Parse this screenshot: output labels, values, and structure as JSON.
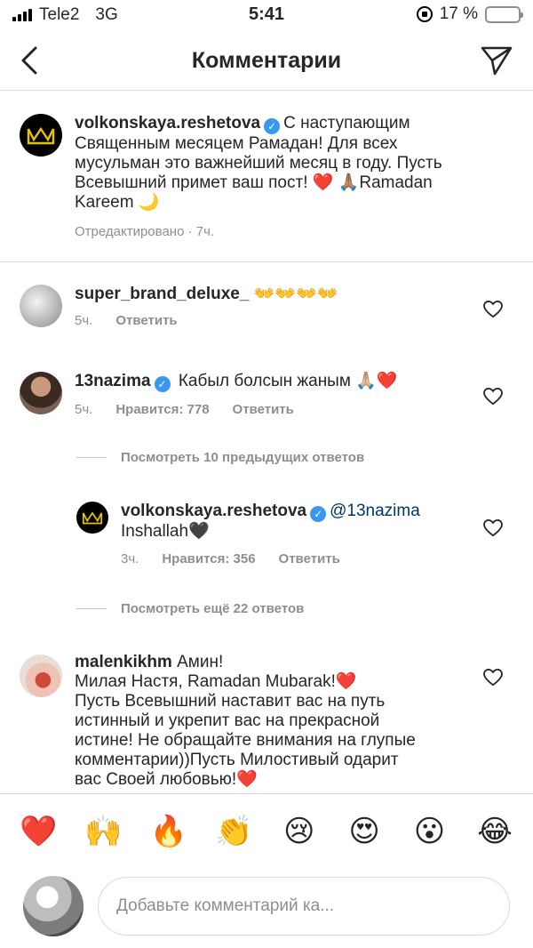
{
  "status_bar": {
    "carrier": "Tele2",
    "network": "3G",
    "time": "5:41",
    "battery_percent": "17 %",
    "battery_level": 0.17
  },
  "header": {
    "title": "Комментарии",
    "back_icon": "chevron-left-icon",
    "send_icon": "paper-plane-icon"
  },
  "caption": {
    "username": "volkonskaya.reshetova",
    "line1": "С наступающим",
    "line2": "Священным месяцем Рамадан! Для всех",
    "line3": "мусульман это важнейший месяц в году. Пусть",
    "line4": "Всевышний примет ваш пост! ❤️ 🙏🏽Ramadan",
    "line5": "Kareem 🌙",
    "meta": "Отредактировано · 7ч."
  },
  "comments": [
    {
      "username": "super_brand_deluxe_",
      "text": "👐👐👐👐",
      "time": "5ч.",
      "reply": "Ответить"
    },
    {
      "username": "13nazima",
      "text": "Кабыл болсын жаным 🙏🏼❤️",
      "time": "5ч.",
      "likes": "Нравится: 778",
      "reply": "Ответить"
    },
    {
      "username": "malenkikhm",
      "line1": "Амин!",
      "line2": "Милая Настя, Ramadan Mubarak!❤️",
      "line3": "Пусть Всевышний наставит вас на путь",
      "line4": "истинный и укрепит вас на прекрасной",
      "line5": "истине! Не обращайте внимания на глупые",
      "line6": "комментарии))Пусть Милостивый одарит",
      "line7": "вас Своей любовью!❤️"
    }
  ],
  "view_prev": "Посмотреть 10 предыдущих ответов",
  "reply": {
    "username": "volkonskaya.reshetova",
    "mention": "@13nazima",
    "text": "Inshallah🖤",
    "time": "3ч.",
    "likes": "Нравится: 356",
    "reply": "Ответить"
  },
  "view_more": "Посмотреть ещё 22 ответов",
  "emoji_bar": [
    "❤️",
    "🙌",
    "🔥",
    "👏",
    "😢",
    "😍",
    "😮",
    "😂"
  ],
  "input": {
    "placeholder": "Добавьте комментарий ка..."
  },
  "colors": {
    "verified": "#3897f0",
    "secondary_text": "#8e8e8e",
    "battery": "#f2c500"
  }
}
